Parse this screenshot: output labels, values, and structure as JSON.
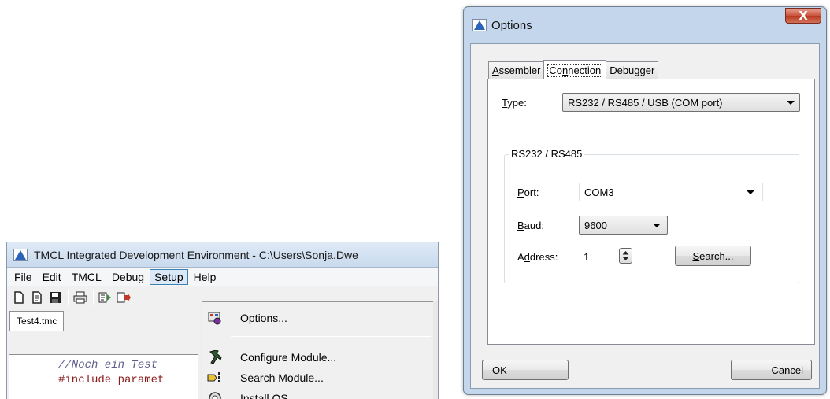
{
  "ide": {
    "title": "TMCL Integrated Development Environment - C:\\Users\\Sonja.Dwe",
    "menus": [
      "File",
      "Edit",
      "TMCL",
      "Debug",
      "Setup",
      "Help"
    ],
    "open_menu": "Setup",
    "toolbar_icons": [
      "new-file-icon",
      "open-file-icon",
      "save-icon",
      "print-icon",
      "assemble-icon",
      "download-icon"
    ],
    "file_tab": "Test4.tmc",
    "code_lines": [
      "//Noch ein Test",
      "#include paramet"
    ],
    "setup_menu_items": [
      {
        "label": "Options...",
        "icon": "options-icon"
      },
      {
        "label": "Configure Module...",
        "icon": "configure-module-icon"
      },
      {
        "label": "Search Module...",
        "icon": "search-module-icon"
      },
      {
        "label": "Install OS",
        "icon": "install-os-icon"
      }
    ]
  },
  "dialog": {
    "title": "Options",
    "close_glyph": "X",
    "tabs": [
      {
        "pre": "",
        "hot": "A",
        "post": "ssembler"
      },
      {
        "pre": "Co",
        "hot": "n",
        "post": "nection"
      },
      {
        "pre": "",
        "hot": "",
        "post": "Debugger"
      }
    ],
    "active_tab": 1,
    "type_label": {
      "hot": "T",
      "post": "ype:"
    },
    "type_value": "RS232 / RS485 / USB (COM port)",
    "group_title": "RS232 / RS485",
    "port_label": {
      "hot": "P",
      "post": "ort:"
    },
    "port_value": "COM3",
    "baud_label": {
      "hot": "B",
      "post": "aud:"
    },
    "baud_value": "9600",
    "address_label": {
      "pre": "A",
      "hot": "d",
      "post": "dress:"
    },
    "address_value": "1",
    "search_button": {
      "hot": "S",
      "post": "earch..."
    },
    "ok_button": {
      "hot": "O",
      "post": "K"
    },
    "cancel_button": {
      "hot": "C",
      "post": "ancel"
    }
  },
  "colors": {
    "dialog_frame": "#c4d6ec",
    "close_button": "#c9523b",
    "app_icon": "#2a63b8"
  }
}
